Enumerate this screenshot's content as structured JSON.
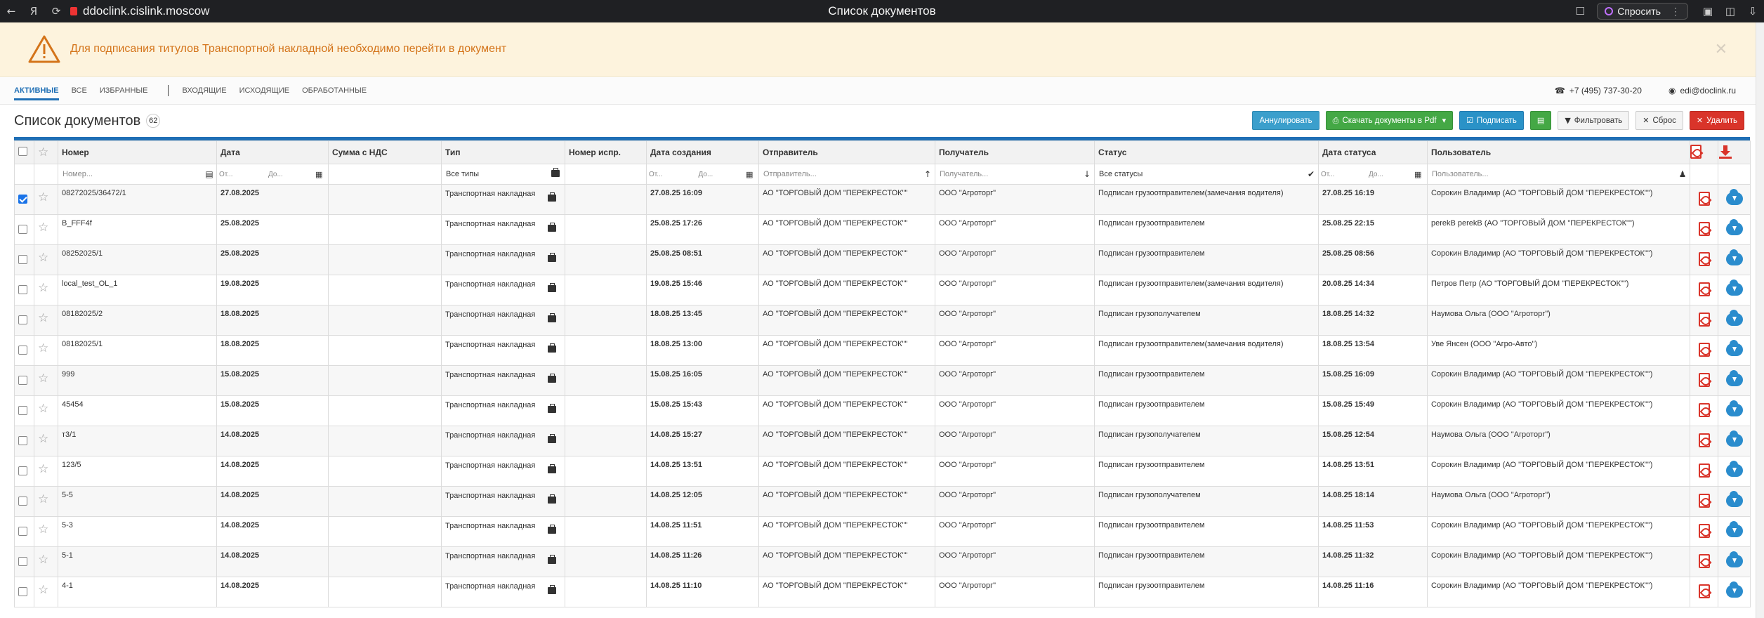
{
  "browser": {
    "url": "ddoclink.cislink.moscow",
    "title": "Список документов",
    "ask_label": "Спросить"
  },
  "warning": {
    "text": "Для подписания титулов Транспортной накладной необходимо перейти в документ"
  },
  "nav": {
    "tabs": [
      "АКТИВНЫЕ",
      "ВСЕ",
      "ИЗБРАННЫЕ",
      "ВХОДЯЩИЕ",
      "ИСХОДЯЩИЕ",
      "ОБРАБОТАННЫЕ"
    ],
    "phone": "+7 (495) 737-30-20",
    "email": "edi@doclink.ru"
  },
  "page": {
    "title": "Список документов",
    "count": "62"
  },
  "actions": {
    "annul": "Аннулировать",
    "download_pdf": "Скачать документы в Pdf",
    "sign": "Подписать",
    "filter": "Фильтровать",
    "reset": "Сброс",
    "delete": "Удалить"
  },
  "columns": {
    "number": "Номер",
    "date": "Дата",
    "sum": "Сумма с НДС",
    "type": "Тип",
    "corr": "Номер испр.",
    "created": "Дата создания",
    "sender": "Отправитель",
    "receiver": "Получатель",
    "status": "Статус",
    "status_date": "Дата статуса",
    "user": "Пользователь"
  },
  "filters": {
    "number": "Номер...",
    "from": "От...",
    "to": "До...",
    "type": "Все типы",
    "sender": "Отправитель...",
    "receiver": "Получатель...",
    "status": "Все статусы",
    "user": "Пользователь..."
  },
  "rows": [
    {
      "checked": true,
      "number": "08272025/36472/1",
      "date": "27.08.2025",
      "type": "Транспортная накладная",
      "created": "27.08.25 16:09",
      "sender": "АО \"ТОРГОВЫЙ ДОМ \"ПЕРЕКРЕСТОК\"\"",
      "receiver": "ООО \"Агроторг\"",
      "status": "Подписан грузоотправителем(замечания водителя)",
      "status_date": "27.08.25 16:19",
      "user": "Сорокин Владимир (АО \"ТОРГОВЫЙ ДОМ \"ПЕРЕКРЕСТОК\"\")"
    },
    {
      "checked": false,
      "number": "B_FFF4f",
      "date": "25.08.2025",
      "type": "Транспортная накладная",
      "created": "25.08.25 17:26",
      "sender": "АО \"ТОРГОВЫЙ ДОМ \"ПЕРЕКРЕСТОК\"\"",
      "receiver": "ООО \"Агроторг\"",
      "status": "Подписан грузоотправителем",
      "status_date": "25.08.25 22:15",
      "user": "perekB perekB (АО \"ТОРГОВЫЙ ДОМ \"ПЕРЕКРЕСТОК\"\")"
    },
    {
      "checked": false,
      "number": "08252025/1",
      "date": "25.08.2025",
      "type": "Транспортная накладная",
      "created": "25.08.25 08:51",
      "sender": "АО \"ТОРГОВЫЙ ДОМ \"ПЕРЕКРЕСТОК\"\"",
      "receiver": "ООО \"Агроторг\"",
      "status": "Подписан грузоотправителем",
      "status_date": "25.08.25 08:56",
      "user": "Сорокин Владимир (АО \"ТОРГОВЫЙ ДОМ \"ПЕРЕКРЕСТОК\"\")"
    },
    {
      "checked": false,
      "number": "local_test_OL_1",
      "date": "19.08.2025",
      "type": "Транспортная накладная",
      "created": "19.08.25 15:46",
      "sender": "АО \"ТОРГОВЫЙ ДОМ \"ПЕРЕКРЕСТОК\"\"",
      "receiver": "ООО \"Агроторг\"",
      "status": "Подписан грузоотправителем(замечания водителя)",
      "status_date": "20.08.25 14:34",
      "user": "Петров Петр (АО \"ТОРГОВЫЙ ДОМ \"ПЕРЕКРЕСТОК\"\")"
    },
    {
      "checked": false,
      "number": "08182025/2",
      "date": "18.08.2025",
      "type": "Транспортная накладная",
      "created": "18.08.25 13:45",
      "sender": "АО \"ТОРГОВЫЙ ДОМ \"ПЕРЕКРЕСТОК\"\"",
      "receiver": "ООО \"Агроторг\"",
      "status": "Подписан грузополучателем",
      "status_date": "18.08.25 14:32",
      "user": "Наумова Ольга (ООО \"Агроторг\")"
    },
    {
      "checked": false,
      "number": "08182025/1",
      "date": "18.08.2025",
      "type": "Транспортная накладная",
      "created": "18.08.25 13:00",
      "sender": "АО \"ТОРГОВЫЙ ДОМ \"ПЕРЕКРЕСТОК\"\"",
      "receiver": "ООО \"Агроторг\"",
      "status": "Подписан грузоотправителем(замечания водителя)",
      "status_date": "18.08.25 13:54",
      "user": "Уве Янсен (ООО \"Агро-Авто\")"
    },
    {
      "checked": false,
      "number": "999",
      "date": "15.08.2025",
      "type": "Транспортная накладная",
      "created": "15.08.25 16:05",
      "sender": "АО \"ТОРГОВЫЙ ДОМ \"ПЕРЕКРЕСТОК\"\"",
      "receiver": "ООО \"Агроторг\"",
      "status": "Подписан грузоотправителем",
      "status_date": "15.08.25 16:09",
      "user": "Сорокин Владимир (АО \"ТОРГОВЫЙ ДОМ \"ПЕРЕКРЕСТОК\"\")"
    },
    {
      "checked": false,
      "number": "45454",
      "date": "15.08.2025",
      "type": "Транспортная накладная",
      "created": "15.08.25 15:43",
      "sender": "АО \"ТОРГОВЫЙ ДОМ \"ПЕРЕКРЕСТОК\"\"",
      "receiver": "ООО \"Агроторг\"",
      "status": "Подписан грузоотправителем",
      "status_date": "15.08.25 15:49",
      "user": "Сорокин Владимир (АО \"ТОРГОВЫЙ ДОМ \"ПЕРЕКРЕСТОК\"\")"
    },
    {
      "checked": false,
      "number": "т3/1",
      "date": "14.08.2025",
      "type": "Транспортная накладная",
      "created": "14.08.25 15:27",
      "sender": "АО \"ТОРГОВЫЙ ДОМ \"ПЕРЕКРЕСТОК\"\"",
      "receiver": "ООО \"Агроторг\"",
      "status": "Подписан грузополучателем",
      "status_date": "15.08.25 12:54",
      "user": "Наумова Ольга (ООО \"Агроторг\")"
    },
    {
      "checked": false,
      "number": "123/5",
      "date": "14.08.2025",
      "type": "Транспортная накладная",
      "created": "14.08.25 13:51",
      "sender": "АО \"ТОРГОВЫЙ ДОМ \"ПЕРЕКРЕСТОК\"\"",
      "receiver": "ООО \"Агроторг\"",
      "status": "Подписан грузоотправителем",
      "status_date": "14.08.25 13:51",
      "user": "Сорокин Владимир (АО \"ТОРГОВЫЙ ДОМ \"ПЕРЕКРЕСТОК\"\")"
    },
    {
      "checked": false,
      "number": "5-5",
      "date": "14.08.2025",
      "type": "Транспортная накладная",
      "created": "14.08.25 12:05",
      "sender": "АО \"ТОРГОВЫЙ ДОМ \"ПЕРЕКРЕСТОК\"\"",
      "receiver": "ООО \"Агроторг\"",
      "status": "Подписан грузополучателем",
      "status_date": "14.08.25 18:14",
      "user": "Наумова Ольга (ООО \"Агроторг\")"
    },
    {
      "checked": false,
      "number": "5-3",
      "date": "14.08.2025",
      "type": "Транспортная накладная",
      "created": "14.08.25 11:51",
      "sender": "АО \"ТОРГОВЫЙ ДОМ \"ПЕРЕКРЕСТОК\"\"",
      "receiver": "ООО \"Агроторг\"",
      "status": "Подписан грузоотправителем",
      "status_date": "14.08.25 11:53",
      "user": "Сорокин Владимир (АО \"ТОРГОВЫЙ ДОМ \"ПЕРЕКРЕСТОК\"\")"
    },
    {
      "checked": false,
      "number": "5-1",
      "date": "14.08.2025",
      "type": "Транспортная накладная",
      "created": "14.08.25 11:26",
      "sender": "АО \"ТОРГОВЫЙ ДОМ \"ПЕРЕКРЕСТОК\"\"",
      "receiver": "ООО \"Агроторг\"",
      "status": "Подписан грузоотправителем",
      "status_date": "14.08.25 11:32",
      "user": "Сорокин Владимир (АО \"ТОРГОВЫЙ ДОМ \"ПЕРЕКРЕСТОК\"\")"
    },
    {
      "checked": false,
      "number": "4-1",
      "date": "14.08.2025",
      "type": "Транспортная накладная",
      "created": "14.08.25 11:10",
      "sender": "АО \"ТОРГОВЫЙ ДОМ \"ПЕРЕКРЕСТОК\"\"",
      "receiver": "ООО \"Агроторг\"",
      "status": "Подписан грузоотправителем",
      "status_date": "14.08.25 11:16",
      "user": "Сорокин Владимир (АО \"ТОРГОВЫЙ ДОМ \"ПЕРЕКРЕСТОК\"\")"
    }
  ]
}
